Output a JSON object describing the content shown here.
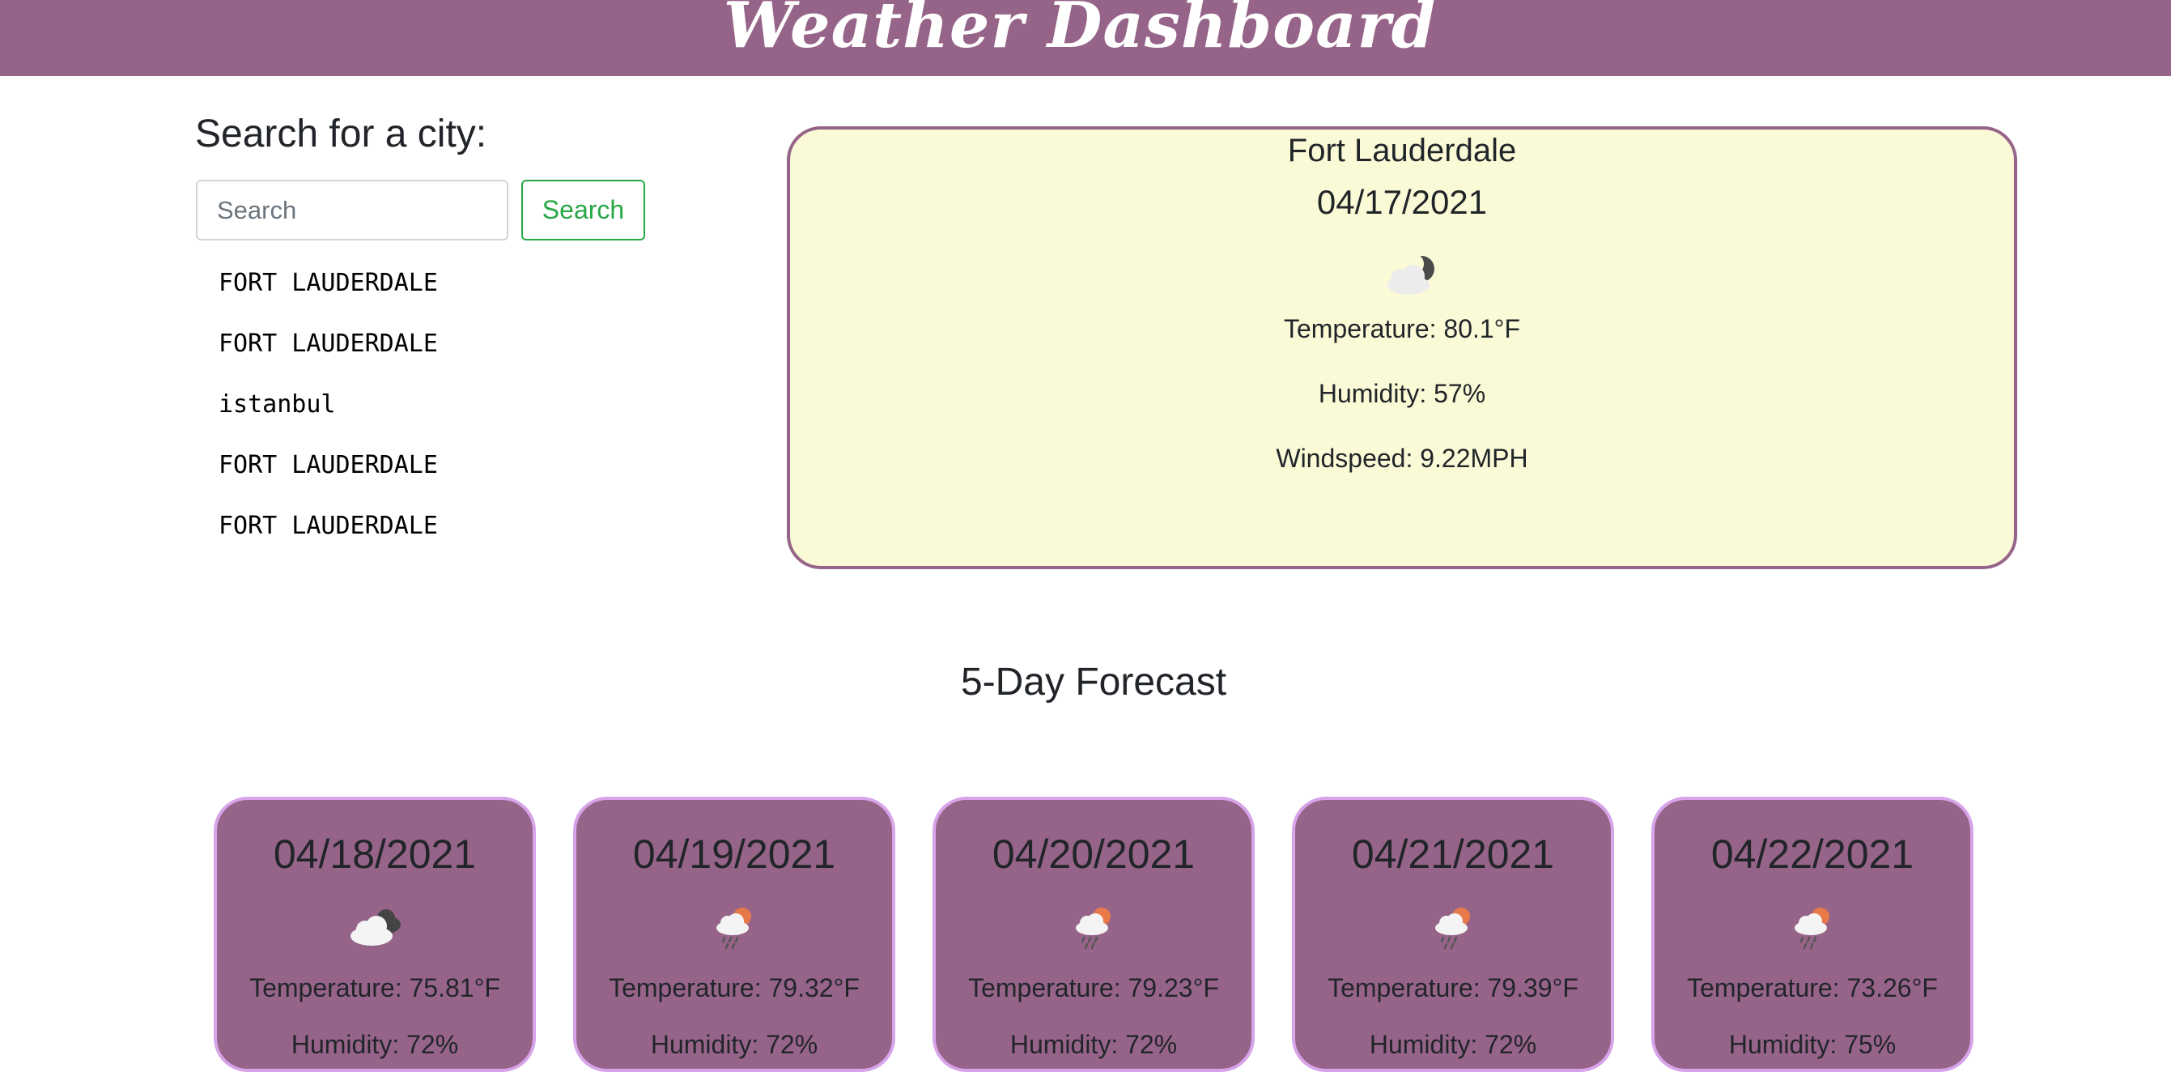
{
  "header": {
    "title": "Weather Dashboard"
  },
  "search": {
    "heading": "Search for a city:",
    "placeholder": "Search",
    "value": "",
    "button_label": "Search"
  },
  "history": [
    "FORT LAUDERDALE",
    "FORT LAUDERDALE",
    "istanbul",
    "FORT LAUDERDALE",
    "FORT LAUDERDALE"
  ],
  "current": {
    "city": "Fort Lauderdale",
    "date": "04/17/2021",
    "icon": "cloudy-night-icon",
    "temperature": "Temperature: 80.1°F",
    "humidity": "Humidity: 57%",
    "windspeed": "Windspeed: 9.22MPH"
  },
  "forecast": {
    "heading": "5-Day Forecast",
    "days": [
      {
        "date": "04/18/2021",
        "icon": "broken-clouds-icon",
        "temperature": "Temperature: 75.81°F",
        "humidity": "Humidity: 72%"
      },
      {
        "date": "04/19/2021",
        "icon": "rain-sun-icon",
        "temperature": "Temperature: 79.32°F",
        "humidity": "Humidity: 72%"
      },
      {
        "date": "04/20/2021",
        "icon": "rain-sun-icon",
        "temperature": "Temperature: 79.23°F",
        "humidity": "Humidity: 72%"
      },
      {
        "date": "04/21/2021",
        "icon": "rain-sun-icon",
        "temperature": "Temperature: 79.39°F",
        "humidity": "Humidity: 72%"
      },
      {
        "date": "04/22/2021",
        "icon": "rain-sun-icon",
        "temperature": "Temperature: 73.26°F",
        "humidity": "Humidity: 75%"
      }
    ]
  },
  "colors": {
    "header": "#976489",
    "current_card_bg": "#fafad6",
    "forecast_card_bg": "#976489",
    "forecast_card_border": "#d7a4ea",
    "search_button": "#28a745"
  }
}
